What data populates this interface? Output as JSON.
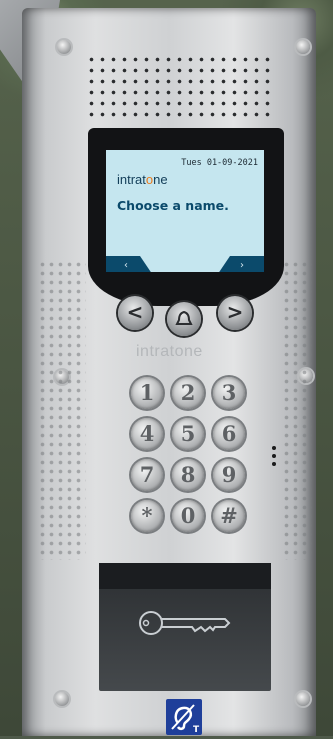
{
  "display": {
    "date": "Tues 01-09-2021",
    "brand_prefix": "intrat",
    "brand_o": "o",
    "brand_suffix": "ne",
    "message": "Choose a name.",
    "left_arrow": "‹",
    "right_arrow": "›"
  },
  "panel": {
    "brand": "intratone",
    "nav_buttons": [
      "<",
      "bell",
      ">"
    ],
    "keypad": [
      "1",
      "2",
      "3",
      "4",
      "5",
      "6",
      "7",
      "8",
      "9",
      "*",
      "0",
      "#"
    ]
  },
  "colors": {
    "screen_bg": "#c5e6ef",
    "screen_text": "#0b4a6b",
    "brand_accent": "#e87a1c",
    "hearing_badge": "#1f3f9a"
  },
  "icons": {
    "reader": "key-icon",
    "badge": "hearing-loop-icon",
    "call": "bell-icon"
  }
}
